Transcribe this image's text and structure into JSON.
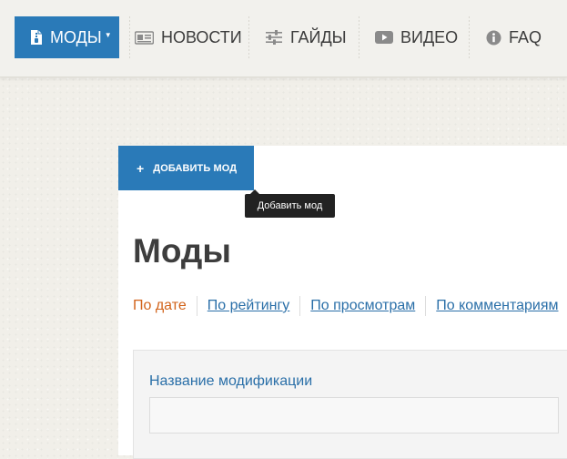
{
  "nav": {
    "items": [
      {
        "label": "МОДЫ",
        "icon": "mod-file-icon",
        "active": true
      },
      {
        "label": "НОВОСТИ",
        "icon": "newspaper-icon"
      },
      {
        "label": "ГАЙДЫ",
        "icon": "sliders-icon"
      },
      {
        "label": "ВИДЕО",
        "icon": "play-icon"
      },
      {
        "label": "FAQ",
        "icon": "info-icon"
      }
    ],
    "caret": "▼"
  },
  "toolbar": {
    "add_button_label": "ДОБАВИТЬ МОД",
    "add_button_icon": "plus-icon",
    "tooltip": "Добавить мод"
  },
  "page": {
    "title": "Моды"
  },
  "sort": {
    "options": [
      {
        "label": "По дате",
        "active": true
      },
      {
        "label": "По рейтингу"
      },
      {
        "label": "По просмотрам"
      },
      {
        "label": "По комментариям"
      }
    ]
  },
  "filter": {
    "name_label": "Название модификации",
    "name_value": ""
  },
  "colors": {
    "accent": "#2a7ab8",
    "link": "#2a6fa8",
    "active_sort": "#d2631a"
  }
}
